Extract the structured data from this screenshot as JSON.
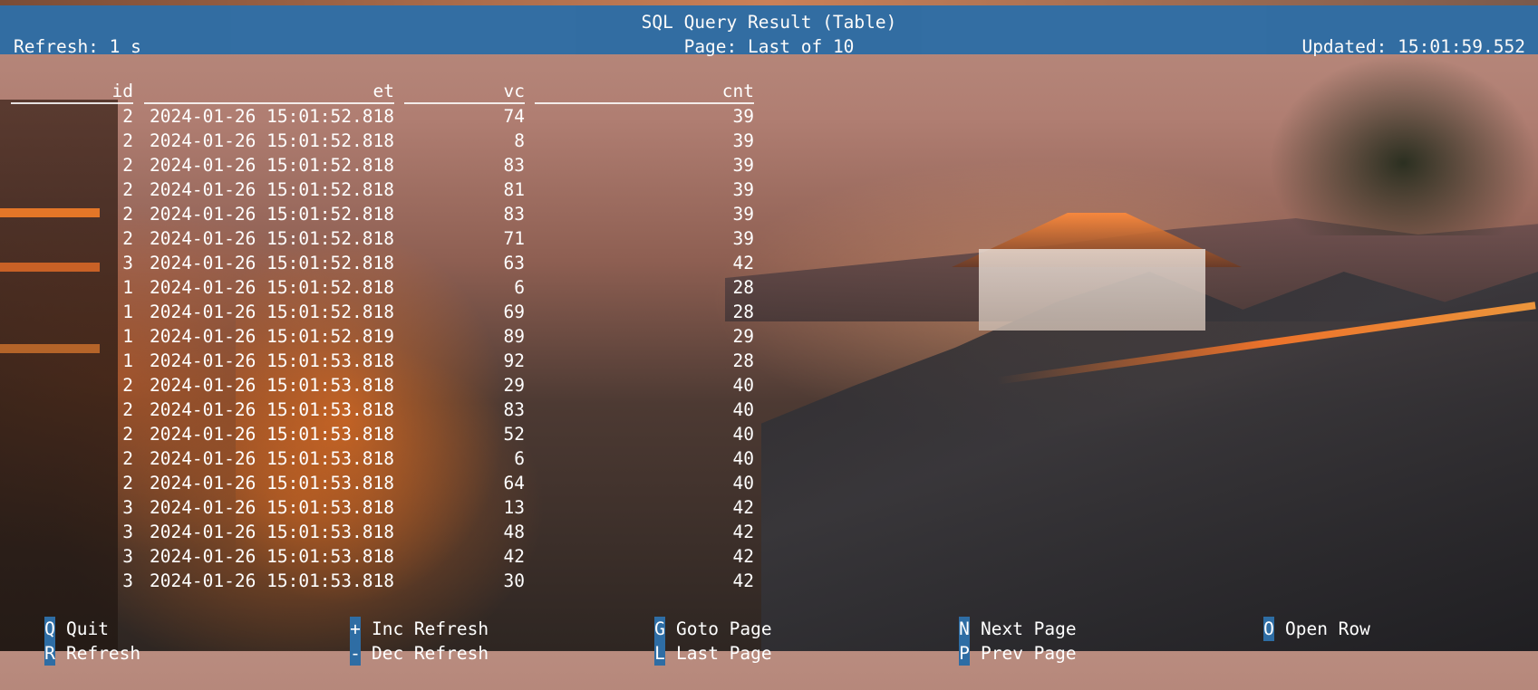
{
  "header": {
    "title": "SQL Query Result (Table)",
    "refresh": "Refresh: 1 s",
    "page": "Page: Last of 10",
    "updated": "Updated: 15:01:59.552"
  },
  "table": {
    "columns": [
      "id",
      "et",
      "vc",
      "cnt"
    ],
    "rows": [
      [
        "2",
        "2024-01-26 15:01:52.818",
        "74",
        "39"
      ],
      [
        "2",
        "2024-01-26 15:01:52.818",
        "8",
        "39"
      ],
      [
        "2",
        "2024-01-26 15:01:52.818",
        "83",
        "39"
      ],
      [
        "2",
        "2024-01-26 15:01:52.818",
        "81",
        "39"
      ],
      [
        "2",
        "2024-01-26 15:01:52.818",
        "83",
        "39"
      ],
      [
        "2",
        "2024-01-26 15:01:52.818",
        "71",
        "39"
      ],
      [
        "3",
        "2024-01-26 15:01:52.818",
        "63",
        "42"
      ],
      [
        "1",
        "2024-01-26 15:01:52.818",
        "6",
        "28"
      ],
      [
        "1",
        "2024-01-26 15:01:52.818",
        "69",
        "28"
      ],
      [
        "1",
        "2024-01-26 15:01:52.819",
        "89",
        "29"
      ],
      [
        "1",
        "2024-01-26 15:01:53.818",
        "92",
        "28"
      ],
      [
        "2",
        "2024-01-26 15:01:53.818",
        "29",
        "40"
      ],
      [
        "2",
        "2024-01-26 15:01:53.818",
        "83",
        "40"
      ],
      [
        "2",
        "2024-01-26 15:01:53.818",
        "52",
        "40"
      ],
      [
        "2",
        "2024-01-26 15:01:53.818",
        "6",
        "40"
      ],
      [
        "2",
        "2024-01-26 15:01:53.818",
        "64",
        "40"
      ],
      [
        "3",
        "2024-01-26 15:01:53.818",
        "13",
        "42"
      ],
      [
        "3",
        "2024-01-26 15:01:53.818",
        "48",
        "42"
      ],
      [
        "3",
        "2024-01-26 15:01:53.818",
        "42",
        "42"
      ],
      [
        "3",
        "2024-01-26 15:01:53.818",
        "30",
        "42"
      ]
    ]
  },
  "footer": {
    "keys": [
      {
        "key": "Q",
        "label": "Quit"
      },
      {
        "key": "R",
        "label": "Refresh"
      },
      {
        "key": "+",
        "label": "Inc Refresh"
      },
      {
        "key": "-",
        "label": "Dec Refresh"
      },
      {
        "key": "G",
        "label": "Goto Page"
      },
      {
        "key": "L",
        "label": "Last Page"
      },
      {
        "key": "N",
        "label": "Next Page"
      },
      {
        "key": "P",
        "label": "Prev Page"
      },
      {
        "key": "O",
        "label": "Open Row"
      }
    ]
  },
  "colors": {
    "header_bg": "#2e6da4",
    "key_bg": "#2e6da4",
    "text": "#ffffff"
  }
}
